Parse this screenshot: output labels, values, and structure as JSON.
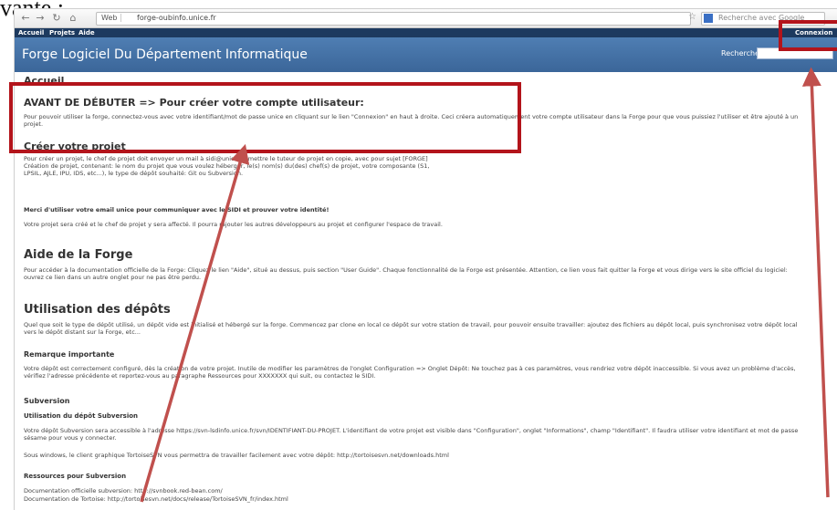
{
  "caption": "vante :",
  "browser": {
    "url_badge": "Web",
    "url": "forge-oubinfo.unice.fr",
    "search_placeholder": "Recherche avec Google"
  },
  "site": {
    "menu": [
      "Accueil",
      "Projets",
      "Aide"
    ],
    "login_label": "Connexion",
    "title": "Forge Logiciel Du Département Informatique",
    "search_label": "Recherche :"
  },
  "content": {
    "clipped_heading": "Accueil",
    "before": {
      "heading": "AVANT DE DÉBUTER => Pour créer votre compte utilisateur:",
      "text": "Pour pouvoir utiliser la forge, connectez-vous avec votre identifiant/mot de passe unice en cliquant sur le lien \"Connexion\" en haut à droite. Ceci créera automatiquement votre compte utilisateur dans la Forge pour que vous puissiez l'utiliser et être ajouté à un projet."
    },
    "create_project": {
      "heading": "Créer votre projet",
      "text": "Pour créer un projet, le chef de projet doit envoyer un mail à sidi@unice.fr, mettre le tuteur de projet en copie, avec pour sujet [FORGE] Création de projet, contenant: le nom du projet que vous voulez héberger, le(s) nom(s) du(des) chef(s) de projet, votre composante (S1, LPSIL, AJLE, IPU, IDS, etc...), le type de dépôt souhaité: Git ou Subversion.",
      "bold_line": "Merci d'utiliser votre email unice pour communiquer avec le SIDI et prouver votre identité!",
      "text2": "Votre projet sera créé et le chef de projet y sera affecté. Il pourra rajouter les autres développeurs au projet et configurer l'espace de travail."
    },
    "help": {
      "heading": "Aide de la Forge",
      "text": "Pour accéder à la documentation officielle de la Forge: Cliquez le lien \"Aide\", situé au dessus, puis section \"User Guide\". Chaque fonctionnalité de la Forge est présentée. Attention, ce lien vous fait quitter la Forge et vous dirige vers le site officiel du logiciel: ouvrez ce lien dans un autre onglet pour ne pas être perdu."
    },
    "repos": {
      "heading": "Utilisation des dépôts",
      "text": "Quel que soit le type de dépôt utilisé, un dépôt vide est initialisé et hébergé sur la forge. Commencez par clone en local ce dépôt sur votre station de travail, pour pouvoir ensuite travailler: ajoutez des fichiers au dépôt local, puis synchronisez votre dépôt local vers le dépôt distant sur la Forge, etc..."
    },
    "important": {
      "heading": "Remarque importante",
      "text": "Votre dépôt est correctement configuré, dès la création de votre projet. Inutile de modifier les paramètres de l'onglet Configuration => Onglet Dépôt: Ne touchez pas à ces paramètres, vous rendriez votre dépôt inaccessible. Si vous avez un problème d'accès, vérifiez l'adresse précédente et reportez-vous au paragraphe Ressources pour XXXXXXX qui suit, ou contactez le SIDI."
    },
    "subversion": {
      "heading": "Subversion",
      "sub_heading": "Utilisation du dépôt Subversion",
      "text": "Votre dépôt Subversion sera accessible à l'adresse https://svn-lsdinfo.unice.fr/svn/IDENTIFIANT-DU-PROJET. L'identifiant de votre projet est visible dans \"Configuration\", onglet \"Informations\", champ \"Identifiant\". Il faudra utiliser votre identifiant et mot de passe sésame pour vous y connecter.",
      "text2": "Sous windows, le client graphique TortoiseSVN vous permettra de travailler facilement avec votre dépôt: http://tortoisesvn.net/downloads.html",
      "resources_heading": "Ressources pour Subversion",
      "doc1": "Documentation officielle subversion: http://svnbook.red-bean.com/",
      "doc2": "Documentation de Tortoise: http://tortoisesvn.net/docs/release/TortoiseSVN_fr/index.html"
    }
  },
  "annotation_color": "#b3141b"
}
